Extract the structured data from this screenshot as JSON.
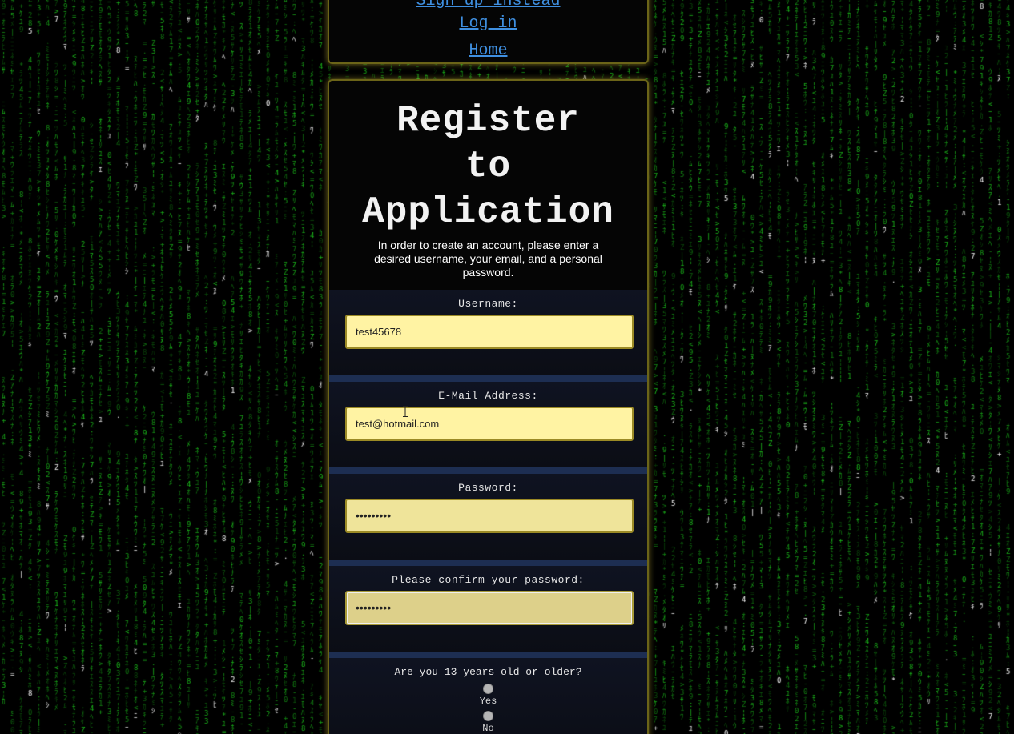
{
  "nav": {
    "partial_link": "Sign up instead",
    "login_label": "Log in",
    "home_label": "Home"
  },
  "page": {
    "title_lines": [
      "Register",
      "to",
      "Application"
    ],
    "intro": "In order to create an account, please enter a desired username, your email, and a personal password."
  },
  "form": {
    "username": {
      "label": "Username:",
      "value": "test45678"
    },
    "email": {
      "label": "E-Mail Address:",
      "value": "test@hotmail.com"
    },
    "password": {
      "label": "Password:",
      "value": "•••••••••"
    },
    "confirm": {
      "label": "Please confirm your password:",
      "value": "•••••••••"
    },
    "age": {
      "question": "Are you 13 years old or older?",
      "options": [
        "Yes",
        "No"
      ]
    }
  },
  "colors": {
    "rain_green": "#1fd61f",
    "panel_border": "#6b6418",
    "link_blue": "#3f8fe0",
    "input_yellow": "#fff3a3"
  }
}
